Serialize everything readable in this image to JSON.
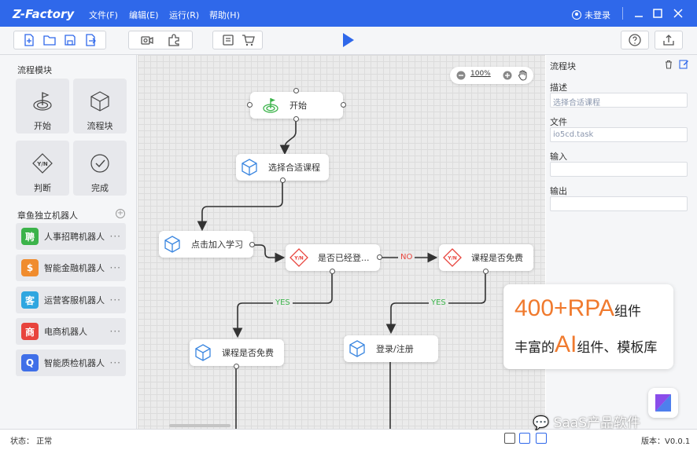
{
  "app": {
    "title": "Z-Factory"
  },
  "menu": [
    "文件(F)",
    "编辑(E)",
    "运行(R)",
    "帮助(H)"
  ],
  "user": {
    "login_label": "未登录"
  },
  "toolbar": {
    "groups": [
      [
        "new-file-icon",
        "open-folder-icon",
        "save-icon",
        "export-icon"
      ],
      [
        "record-icon",
        "plugin-icon"
      ],
      [
        "script-icon",
        "store-icon"
      ]
    ],
    "run_icon": "play-icon",
    "help_icon": "help-icon",
    "upload_icon": "upload-icon"
  },
  "left_panel": {
    "modules_title": "流程模块",
    "modules": [
      {
        "label": "开始",
        "icon": "target-icon"
      },
      {
        "label": "流程块",
        "icon": "cube-icon"
      },
      {
        "label": "判断",
        "icon": "yn-diamond-icon"
      },
      {
        "label": "完成",
        "icon": "check-circle-icon"
      }
    ],
    "robots_title": "章鱼独立机器人",
    "robots": [
      {
        "label": "人事招聘机器人",
        "icon_text": "聘",
        "color": "#3bb34a"
      },
      {
        "label": "智能金融机器人",
        "icon_text": "$",
        "color": "#f08c2e"
      },
      {
        "label": "运营客服机器人",
        "icon_text": "客",
        "color": "#2fa6e0"
      },
      {
        "label": "电商机器人",
        "icon_text": "商",
        "color": "#e8443d"
      },
      {
        "label": "智能质检机器人",
        "icon_text": "Q",
        "color": "#3f6fe8"
      }
    ],
    "more_label": "···"
  },
  "canvas": {
    "zoom": "100%",
    "nodes": [
      {
        "id": "start",
        "label": "开始",
        "icon": "target-icon"
      },
      {
        "id": "choose",
        "label": "选择合适课程",
        "icon": "cube-icon"
      },
      {
        "id": "join",
        "label": "点击加入学习",
        "icon": "cube-icon"
      },
      {
        "id": "logged",
        "label": "是否已经登...",
        "icon": "yn-diamond-icon"
      },
      {
        "id": "free1",
        "label": "课程是否免费",
        "icon": "yn-diamond-icon"
      },
      {
        "id": "free2",
        "label": "课程是否免费",
        "icon": "cube-icon"
      },
      {
        "id": "login",
        "label": "登录/注册",
        "icon": "cube-icon"
      }
    ],
    "edge_labels": {
      "no": "NO",
      "yes1": "YES",
      "yes2": "YES"
    }
  },
  "promo": {
    "line1_big": "400+RPA",
    "line1_small": "组件",
    "line2_prefix": "丰富的",
    "line2_big": "AI",
    "line2_suffix": "组件、模板库"
  },
  "right_panel": {
    "title": "流程块",
    "fields": [
      {
        "label": "描述",
        "value": "选择合适课程"
      },
      {
        "label": "文件",
        "value": "io5cd.task"
      },
      {
        "label": "输入",
        "value": ""
      },
      {
        "label": "输出",
        "value": ""
      }
    ]
  },
  "status": {
    "text": "状态：  正常",
    "version": "版本：V0.0.1"
  },
  "watermark": {
    "text": "SaaS产品软件"
  },
  "colors": {
    "brand": "#2f68ea",
    "node_red": "#e8443d",
    "node_blue": "#3a86e0",
    "yes": "#3bb34a",
    "no": "#e8443d",
    "accent_orange": "#f07a2e"
  }
}
